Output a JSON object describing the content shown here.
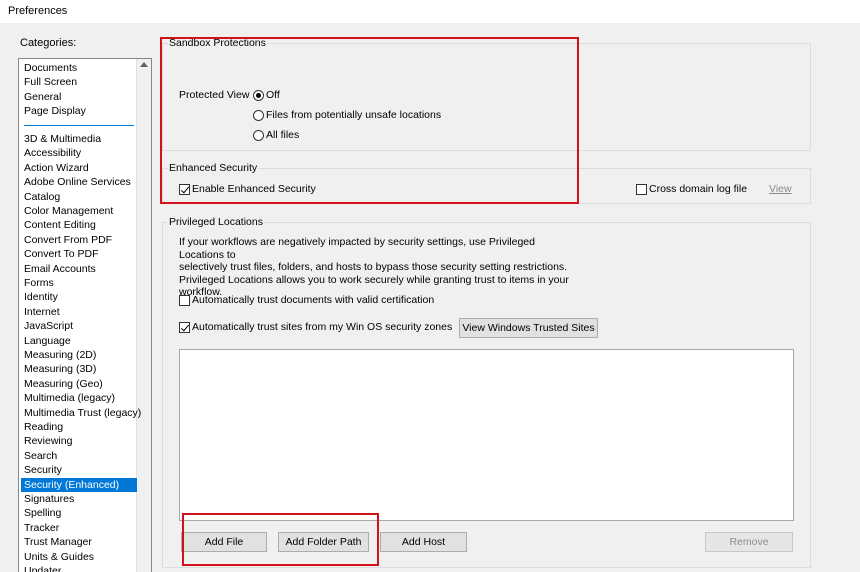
{
  "window": {
    "title": "Preferences"
  },
  "categories": {
    "label": "Categories:",
    "top_items": [
      "Documents",
      "Full Screen",
      "General",
      "Page Display"
    ],
    "items": [
      "3D & Multimedia",
      "Accessibility",
      "Action Wizard",
      "Adobe Online Services",
      "Catalog",
      "Color Management",
      "Content Editing",
      "Convert From PDF",
      "Convert To PDF",
      "Email Accounts",
      "Forms",
      "Identity",
      "Internet",
      "JavaScript",
      "Language",
      "Measuring (2D)",
      "Measuring (3D)",
      "Measuring (Geo)",
      "Multimedia (legacy)",
      "Multimedia Trust (legacy)",
      "Reading",
      "Reviewing",
      "Search",
      "Security",
      "Security (Enhanced)",
      "Signatures",
      "Spelling",
      "Tracker",
      "Trust Manager",
      "Units & Guides",
      "Updater"
    ],
    "selected": "Security (Enhanced)"
  },
  "sandbox": {
    "title": "Sandbox Protections",
    "protected_view_label": "Protected View",
    "options": [
      "Off",
      "Files from potentially unsafe locations",
      "All files"
    ],
    "selected": "Off"
  },
  "enhanced": {
    "title": "Enhanced Security",
    "enable_label": "Enable Enhanced Security",
    "enable_checked": true,
    "cross_domain_label": "Cross domain log file",
    "cross_domain_checked": false,
    "view_link": "View"
  },
  "privileged": {
    "title": "Privileged Locations",
    "description": "If your workflows are negatively impacted by security settings, use Privileged Locations to selectively trust files, folders, and hosts to bypass those security setting restrictions. Privileged Locations allows you to work securely while granting trust to items in your workflow.",
    "desc_lines": [
      "If your workflows are negatively impacted by security settings, use Privileged Locations to",
      "selectively trust files, folders, and hosts to bypass those security setting restrictions.",
      "Privileged Locations allows you to work securely while granting trust to items in your",
      "workflow."
    ],
    "auto_cert_label": "Automatically trust documents with valid certification",
    "auto_cert_checked": false,
    "auto_sites_label": "Automatically trust sites from my Win OS security zones",
    "auto_sites_checked": true,
    "view_trusted_button": "View Windows Trusted Sites",
    "add_file_button": "Add File",
    "add_folder_button": "Add Folder Path",
    "add_host_button": "Add Host",
    "remove_button": "Remove"
  },
  "colors": {
    "highlight": "#d0121b",
    "selection": "#0078d7"
  }
}
